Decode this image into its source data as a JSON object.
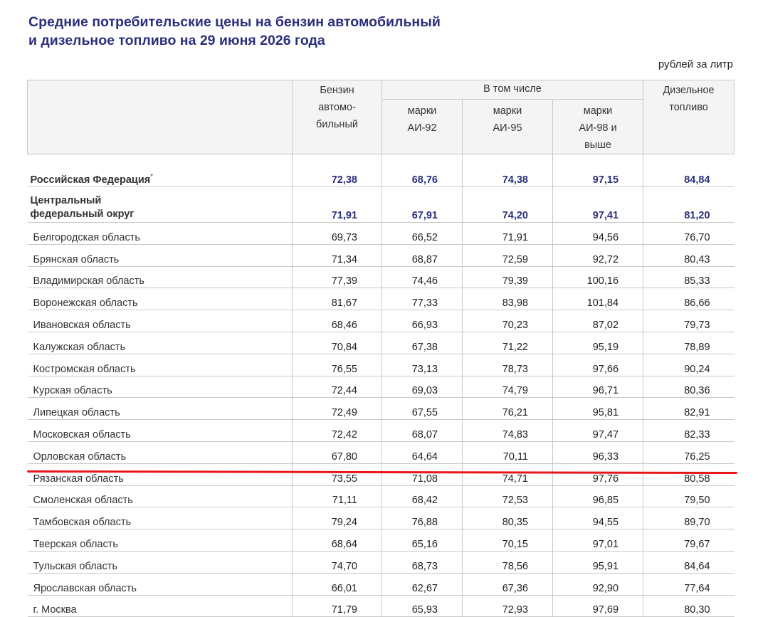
{
  "title_line1": "Средние потребительские цены на бензин автомобильный",
  "title_line2": "и дизельное топливо на 29 июня 2026 года",
  "units": "рублей за литр",
  "headers": {
    "gasoline": "Бензин автомо-бильный",
    "including": "В том числе",
    "ai92": "марки АИ-92",
    "ai95": "марки АИ-95",
    "ai98": "марки АИ-98 и выше",
    "diesel": "Дизельное топливо"
  },
  "rf": {
    "name": "Российская Федерация",
    "mark": "*",
    "values": [
      "72,38",
      "68,76",
      "74,38",
      "97,15",
      "84,84"
    ]
  },
  "cfo": {
    "name": "Центральный федеральный округ",
    "values": [
      "71,91",
      "67,91",
      "74,20",
      "97,41",
      "81,20"
    ]
  },
  "rows": [
    {
      "name": "Белгородская область",
      "values": [
        "69,73",
        "66,52",
        "71,91",
        "94,56",
        "76,70"
      ]
    },
    {
      "name": "Брянская область",
      "values": [
        "71,34",
        "68,87",
        "72,59",
        "92,72",
        "80,43"
      ]
    },
    {
      "name": "Владимирская область",
      "values": [
        "77,39",
        "74,46",
        "79,39",
        "100,16",
        "85,33"
      ]
    },
    {
      "name": "Воронежская область",
      "values": [
        "81,67",
        "77,33",
        "83,98",
        "101,84",
        "86,66"
      ]
    },
    {
      "name": "Ивановская область",
      "values": [
        "68,46",
        "66,93",
        "70,23",
        "87,02",
        "79,73"
      ]
    },
    {
      "name": "Калужская область",
      "values": [
        "70,84",
        "67,38",
        "71,22",
        "95,19",
        "78,89"
      ]
    },
    {
      "name": "Костромская область",
      "values": [
        "76,55",
        "73,13",
        "78,73",
        "97,66",
        "90,24"
      ]
    },
    {
      "name": "Курская область",
      "values": [
        "72,44",
        "69,03",
        "74,79",
        "96,71",
        "80,36"
      ]
    },
    {
      "name": "Липецкая область",
      "values": [
        "72,49",
        "67,55",
        "76,21",
        "95,81",
        "82,91"
      ]
    },
    {
      "name": "Московская область",
      "values": [
        "72,42",
        "68,07",
        "74,83",
        "97,47",
        "82,33"
      ]
    },
    {
      "name": "Орловская область",
      "values": [
        "67,80",
        "64,64",
        "70,11",
        "96,33",
        "76,25"
      ]
    },
    {
      "name": "Рязанская область",
      "values": [
        "73,55",
        "71,08",
        "74,71",
        "97,76",
        "80,58"
      ]
    },
    {
      "name": "Смоленская область",
      "values": [
        "71,11",
        "68,42",
        "72,53",
        "96,85",
        "79,50"
      ]
    },
    {
      "name": "Тамбовская область",
      "values": [
        "79,24",
        "76,88",
        "80,35",
        "94,55",
        "89,70"
      ]
    },
    {
      "name": "Тверская область",
      "values": [
        "68,64",
        "65,16",
        "70,15",
        "97,01",
        "79,67"
      ]
    },
    {
      "name": "Тульская область",
      "values": [
        "74,70",
        "68,73",
        "78,56",
        "95,91",
        "84,64"
      ]
    },
    {
      "name": "Ярославская область",
      "values": [
        "66,01",
        "62,67",
        "67,36",
        "92,90",
        "77,64"
      ]
    },
    {
      "name": "г. Москва",
      "values": [
        "71,79",
        "65,93",
        "72,93",
        "97,69",
        "80,30"
      ]
    }
  ],
  "colors": {
    "title": "#2b2f7d",
    "highlight_underline": "#e8161b",
    "border": "#c8c8c8"
  }
}
